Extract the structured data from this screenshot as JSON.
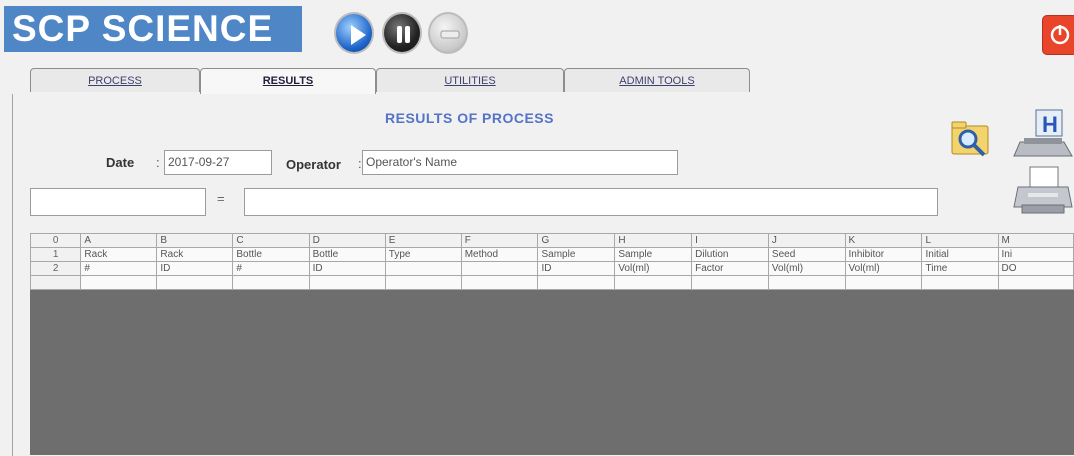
{
  "app": {
    "logo_text": "SCP SCIENCE"
  },
  "controls": {
    "play_icon": "play-icon",
    "pause_icon": "pause-icon",
    "stop_icon": "stop-icon",
    "power_icon": "power-icon"
  },
  "tabs": [
    {
      "label": "PROCESS",
      "active": false
    },
    {
      "label": "RESULTS",
      "active": true
    },
    {
      "label": "UTILITIES",
      "active": false
    },
    {
      "label": "ADMIN TOOLS",
      "active": false
    }
  ],
  "results": {
    "heading": "RESULTS OF PROCESS",
    "date_label": "Date",
    "date_value": "2017-09-27",
    "operator_label": "Operator",
    "operator_value": "Operator's Name",
    "colon": ":",
    "equals": "=",
    "formula_cell": "",
    "formula_value": ""
  },
  "toolbar_icons": [
    "search-icon",
    "save-disk-icon",
    "print-icon"
  ],
  "grid": {
    "columns": [
      "A",
      "B",
      "C",
      "D",
      "E",
      "F",
      "G",
      "H",
      "I",
      "J",
      "K",
      "L",
      "M"
    ],
    "rows": [
      {
        "n": "0",
        "cells": [
          "A",
          "B",
          "C",
          "D",
          "E",
          "F",
          "G",
          "H",
          "I",
          "J",
          "K",
          "L",
          "M"
        ]
      },
      {
        "n": "1",
        "cells": [
          "Rack",
          "Rack",
          "Bottle",
          "Bottle",
          "Type",
          "Method",
          "Sample",
          "Sample",
          "Dilution",
          "Seed",
          "Inhibitor",
          "Initial",
          "Ini"
        ]
      },
      {
        "n": "2",
        "cells": [
          "#",
          "ID",
          "#",
          "ID",
          "",
          "",
          "ID",
          "Vol(ml)",
          "Factor",
          "Vol(ml)",
          "Vol(ml)",
          "Time",
          "DO"
        ]
      },
      {
        "n": "",
        "cells": [
          "",
          "",
          "",
          "",
          "",
          "",
          "",
          "",
          "",
          "",
          "",
          "",
          ""
        ]
      }
    ]
  },
  "colors": {
    "logo_bg": "#4f86c6",
    "heading": "#5574c8",
    "grid_empty_area": "#6e6e6e",
    "power_button": "#e8452a"
  }
}
